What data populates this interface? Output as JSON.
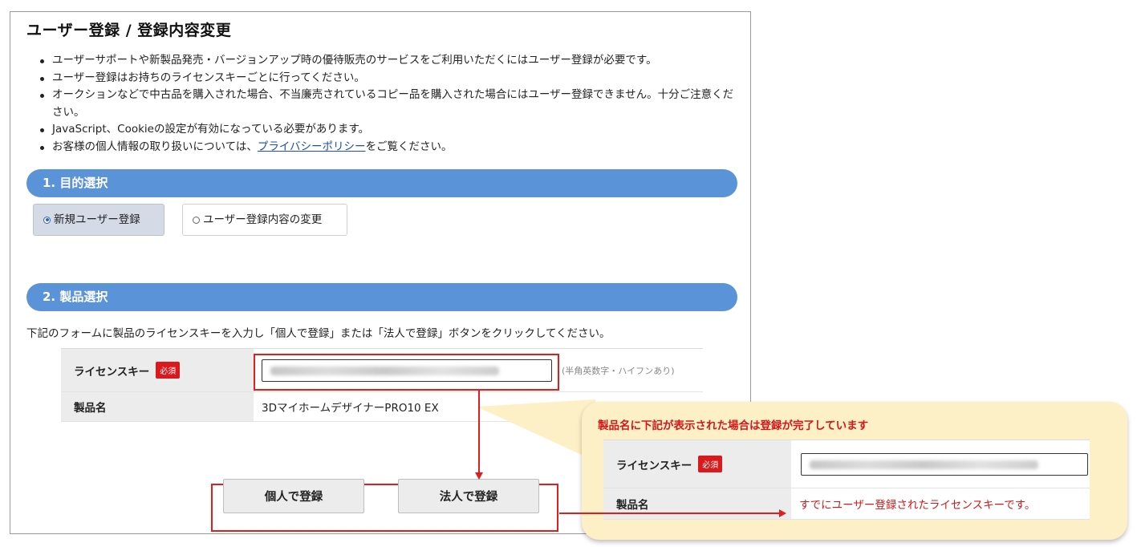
{
  "page_title": "ユーザー登録 / 登録内容変更",
  "notes": [
    "ユーザーサポートや新製品発売・バージョンアップ時の優待販売のサービスをご利用いただくにはユーザー登録が必要です。",
    "ユーザー登録はお持ちのライセンスキーごとに行ってください。",
    "オークションなどで中古品を購入された場合、不当廉売されているコピー品を購入された場合にはユーザー登録できません。十分ご注意ください。",
    "JavaScript、Cookieの設定が有効になっている必要があります。"
  ],
  "privacy_note": {
    "prefix": "お客様の個人情報の取り扱いについては、",
    "link": "プライバシーポリシー",
    "suffix": "をご覧ください。"
  },
  "section1": {
    "title": "1. 目的選択",
    "options": [
      {
        "label": "新規ユーザー登録",
        "selected": true
      },
      {
        "label": "ユーザー登録内容の変更",
        "selected": false
      }
    ]
  },
  "section2": {
    "title": "2. 製品選択",
    "instruction": "下記のフォームに製品のライセンスキーを入力し「個人で登録」または「法人で登録」ボタンをクリックしてください。",
    "license_label": "ライセンスキー",
    "required_badge": "必須",
    "license_hint": "(半角英数字・ハイフンあり)",
    "product_label": "製品名",
    "product_value": "3DマイホームデザイナーPRO10 EX",
    "buttons": {
      "personal": "個人で登録",
      "corporate": "法人で登録"
    }
  },
  "callout": {
    "title": "製品名に下記が表示された場合は登録が完了しています",
    "license_label": "ライセンスキー",
    "required_badge": "必須",
    "product_label": "製品名",
    "message": "すでにユーザー登録されたライセンスキーです。"
  },
  "colors": {
    "section_bar": "#5b93d9",
    "highlight_red": "#e21d1d",
    "callout_bg": "#fdefc6",
    "required_badge": "#d9191c"
  }
}
